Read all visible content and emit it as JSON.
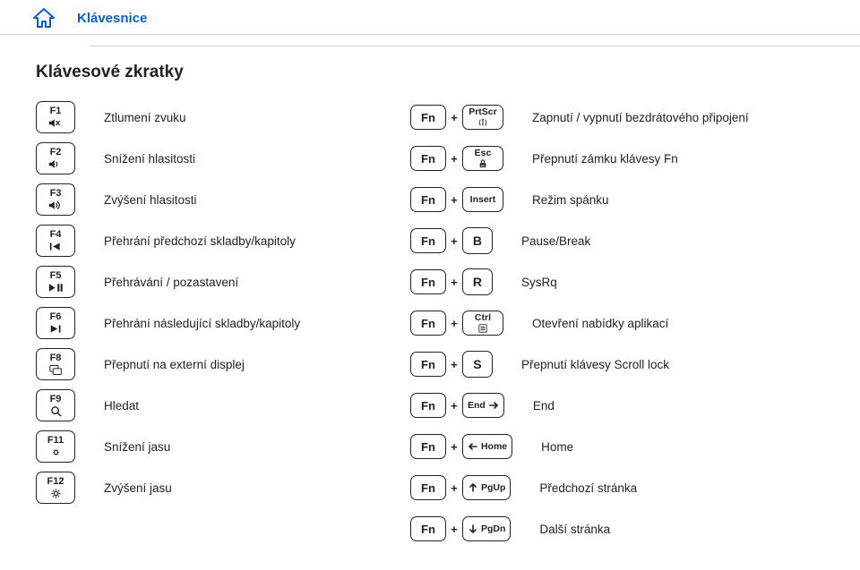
{
  "breadcrumb": {
    "label": "Klávesnice"
  },
  "heading": "Klávesové zkratky",
  "plus": "+",
  "fn": "Fn",
  "left": [
    {
      "key": "F1",
      "iconSvg": "mute",
      "desc": "Ztlumení zvuku"
    },
    {
      "key": "F2",
      "iconSvg": "voldn",
      "desc": "Snížení hlasitosti"
    },
    {
      "key": "F3",
      "iconSvg": "volup",
      "desc": "Zvýšení hlasitosti"
    },
    {
      "key": "F4",
      "iconSvg": "prev",
      "desc": "Přehrání předchozí skladby/kapitoly"
    },
    {
      "key": "F5",
      "iconSvg": "playpause",
      "desc": "Přehrávání / pozastavení"
    },
    {
      "key": "F6",
      "iconSvg": "next",
      "desc": "Přehrání následující skladby/kapitoly"
    },
    {
      "key": "F8",
      "iconSvg": "display",
      "desc": "Přepnutí na externí displej"
    },
    {
      "key": "F9",
      "iconSvg": "search",
      "desc": "Hledat"
    },
    {
      "key": "F11",
      "iconSvg": "brightdn",
      "desc": "Snížení jasu"
    },
    {
      "key": "F12",
      "iconSvg": "brightup",
      "desc": "Zvýšení jasu"
    }
  ],
  "right": [
    {
      "key2": {
        "type": "smallIcon",
        "label": "PrtScr",
        "iconSvg": "wifi"
      },
      "desc": "Zapnutí / vypnutí bezdrátového připojení"
    },
    {
      "key2": {
        "type": "smallIcon",
        "label": "Esc",
        "iconSvg": "lock"
      },
      "desc": "Přepnutí zámku klávesy Fn"
    },
    {
      "key2": {
        "type": "small",
        "label": "Insert"
      },
      "desc": "Režim spánku"
    },
    {
      "key2": {
        "type": "letter",
        "label": "B"
      },
      "desc": "Pause/Break"
    },
    {
      "key2": {
        "type": "letter",
        "label": "R"
      },
      "desc": "SysRq"
    },
    {
      "key2": {
        "type": "smallIcon",
        "label": "Ctrl",
        "iconSvg": "menu"
      },
      "desc": "Otevření nabídky aplikací"
    },
    {
      "key2": {
        "type": "letter",
        "label": "S"
      },
      "desc": "Přepnutí klávesy Scroll lock"
    },
    {
      "key2": {
        "type": "smallArr",
        "label": "End",
        "arrow": "right"
      },
      "desc": "End"
    },
    {
      "key2": {
        "type": "smallArr",
        "label": "Home",
        "arrow": "left"
      },
      "desc": "Home"
    },
    {
      "key2": {
        "type": "smallArr",
        "label": "PgUp",
        "arrow": "up"
      },
      "desc": "Předchozí stránka"
    },
    {
      "key2": {
        "type": "smallArr",
        "label": "PgDn",
        "arrow": "down"
      },
      "desc": "Další stránka"
    }
  ]
}
